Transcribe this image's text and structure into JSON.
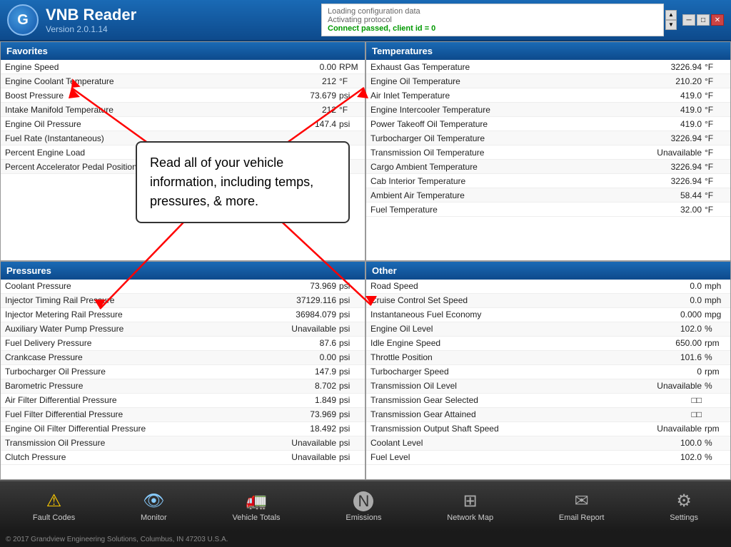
{
  "app": {
    "name": "VNB Reader",
    "version": "Version 2.0.1.14",
    "logo_letter": "G"
  },
  "status": {
    "line1": "Loading configuration data",
    "line2": "Activating protocol",
    "line3": "Connect passed, client id = 0"
  },
  "callout": {
    "text": "Read all of your vehicle information, including temps, pressures, & more."
  },
  "favorites": {
    "header": "Favorites",
    "rows": [
      {
        "label": "Engine Speed",
        "value": "0.00",
        "unit": "RPM"
      },
      {
        "label": "Engine Coolant Temperature",
        "value": "212",
        "unit": "°F"
      },
      {
        "label": "Boost Pressure",
        "value": "73.679",
        "unit": "psi"
      },
      {
        "label": "Intake Manifold Temperature",
        "value": "212",
        "unit": "°F"
      },
      {
        "label": "Engine Oil Pressure",
        "value": "147.4",
        "unit": "psi"
      },
      {
        "label": "Fuel Rate (Instantaneous)",
        "value": "",
        "unit": ""
      },
      {
        "label": "Percent Engine Load",
        "value": "",
        "unit": ""
      },
      {
        "label": "Percent Accelerator Pedal Position",
        "value": "",
        "unit": ""
      }
    ]
  },
  "temperatures": {
    "header": "Temperatures",
    "rows": [
      {
        "label": "Exhaust Gas Temperature",
        "value": "3226.94",
        "unit": "°F"
      },
      {
        "label": "Engine Oil Temperature",
        "value": "210.20",
        "unit": "°F"
      },
      {
        "label": "Air Inlet Temperature",
        "value": "419.0",
        "unit": "°F"
      },
      {
        "label": "Engine Intercooler Temperature",
        "value": "419.0",
        "unit": "°F"
      },
      {
        "label": "Power Takeoff Oil Temperature",
        "value": "419.0",
        "unit": "°F"
      },
      {
        "label": "Turbocharger Oil Temperature",
        "value": "3226.94",
        "unit": "°F"
      },
      {
        "label": "Transmission Oil Temperature",
        "value": "Unavailable",
        "unit": "°F"
      },
      {
        "label": "Cargo Ambient Temperature",
        "value": "3226.94",
        "unit": "°F"
      },
      {
        "label": "Cab Interior Temperature",
        "value": "3226.94",
        "unit": "°F"
      },
      {
        "label": "Ambient Air Temperature",
        "value": "58.44",
        "unit": "°F"
      },
      {
        "label": "Fuel Temperature",
        "value": "32.00",
        "unit": "°F"
      }
    ]
  },
  "pressures": {
    "header": "Pressures",
    "rows": [
      {
        "label": "Coolant Pressure",
        "value": "73.969",
        "unit": "psi"
      },
      {
        "label": "Injector Timing Rail Pressure",
        "value": "37129.116",
        "unit": "psi"
      },
      {
        "label": "Injector Metering Rail Pressure",
        "value": "36984.079",
        "unit": "psi"
      },
      {
        "label": "Auxiliary Water Pump Pressure",
        "value": "Unavailable",
        "unit": "psi"
      },
      {
        "label": "Fuel Delivery Pressure",
        "value": "87.6",
        "unit": "psi"
      },
      {
        "label": "Crankcase Pressure",
        "value": "0.00",
        "unit": "psi"
      },
      {
        "label": "Turbocharger Oil Pressure",
        "value": "147.9",
        "unit": "psi"
      },
      {
        "label": "Barometric Pressure",
        "value": "8.702",
        "unit": "psi"
      },
      {
        "label": "Air Filter Differential Pressure",
        "value": "1.849",
        "unit": "psi"
      },
      {
        "label": "Fuel Filter Differential Pressure",
        "value": "73.969",
        "unit": "psi"
      },
      {
        "label": "Engine Oil Filter Differential Pressure",
        "value": "18.492",
        "unit": "psi"
      },
      {
        "label": "Transmission Oil Pressure",
        "value": "Unavailable",
        "unit": "psi"
      },
      {
        "label": "Clutch Pressure",
        "value": "Unavailable",
        "unit": "psi"
      }
    ]
  },
  "other": {
    "header": "Other",
    "rows": [
      {
        "label": "Road Speed",
        "value": "0.0",
        "unit": "mph"
      },
      {
        "label": "Cruise Control Set Speed",
        "value": "0.0",
        "unit": "mph"
      },
      {
        "label": "Instantaneous Fuel Economy",
        "value": "0.000",
        "unit": "mpg"
      },
      {
        "label": "Engine Oil Level",
        "value": "102.0",
        "unit": "%"
      },
      {
        "label": "Idle Engine Speed",
        "value": "650.00",
        "unit": "rpm"
      },
      {
        "label": "Throttle Position",
        "value": "101.6",
        "unit": "%"
      },
      {
        "label": "Turbocharger Speed",
        "value": "0",
        "unit": "rpm"
      },
      {
        "label": "Transmission Oil Level",
        "value": "Unavailable",
        "unit": "%"
      },
      {
        "label": "Transmission Gear Selected",
        "value": "□□",
        "unit": ""
      },
      {
        "label": "Transmission Gear Attained",
        "value": "□□",
        "unit": ""
      },
      {
        "label": "Transmission Output Shaft Speed",
        "value": "Unavailable",
        "unit": "rpm"
      },
      {
        "label": "Coolant Level",
        "value": "100.0",
        "unit": "%"
      },
      {
        "label": "Fuel Level",
        "value": "102.0",
        "unit": "%"
      }
    ]
  },
  "nav": {
    "items": [
      {
        "label": "Fault Codes",
        "icon": "⚠"
      },
      {
        "label": "Monitor",
        "icon": "👁"
      },
      {
        "label": "Vehicle Totals",
        "icon": "🚛"
      },
      {
        "label": "Emissions",
        "icon": "◎"
      },
      {
        "label": "Network Map",
        "icon": "⊞"
      },
      {
        "label": "Email Report",
        "icon": "✉"
      },
      {
        "label": "Settings",
        "icon": "⚙"
      }
    ]
  },
  "footer": {
    "text": "© 2017 Grandview Engineering Solutions, Columbus, IN 47203 U.S.A."
  }
}
